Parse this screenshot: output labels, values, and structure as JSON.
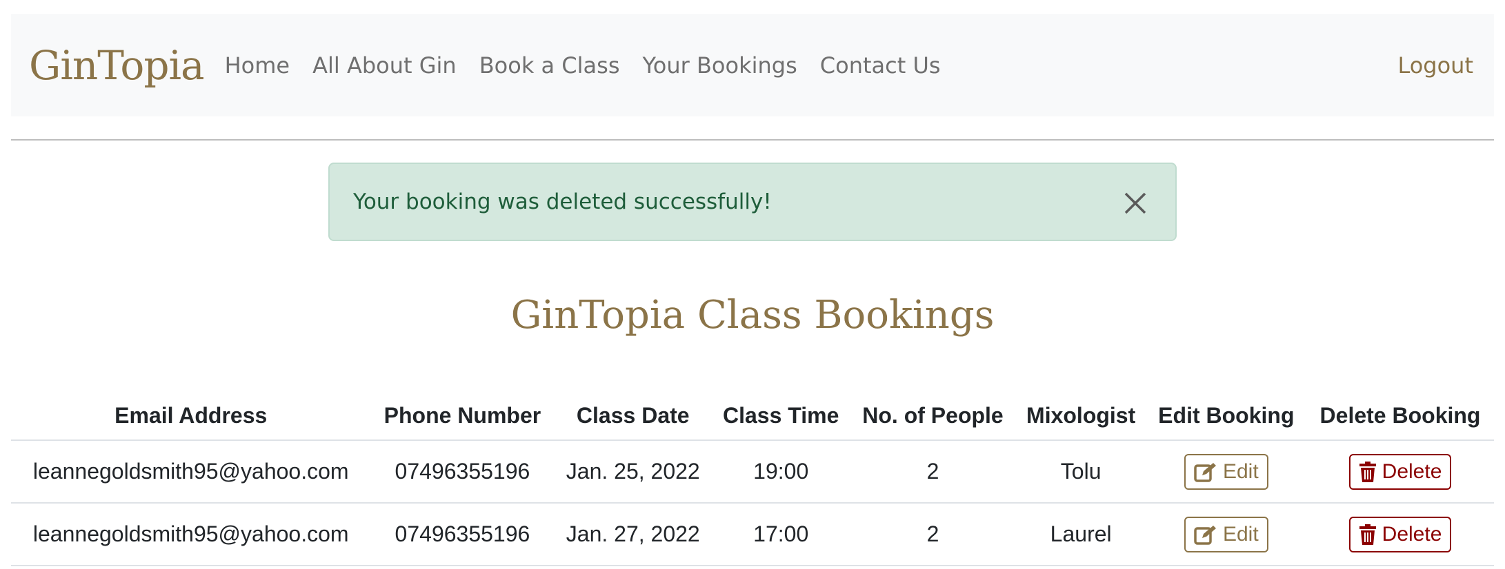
{
  "navbar": {
    "brand": "GinTopia",
    "links": [
      "Home",
      "All About Gin",
      "Book a Class",
      "Your Bookings",
      "Contact Us"
    ],
    "logout": "Logout"
  },
  "alert": {
    "message": "Your booking was deleted successfully!",
    "close_icon": "close-icon"
  },
  "page_title": "GinTopia Class Bookings",
  "table": {
    "headers": [
      "Email Address",
      "Phone Number",
      "Class Date",
      "Class Time",
      "No. of People",
      "Mixologist",
      "Edit Booking",
      "Delete Booking"
    ],
    "rows": [
      {
        "email": "leannegoldsmith95@yahoo.com",
        "phone": "07496355196",
        "date": "Jan. 25, 2022",
        "time": "19:00",
        "people": "2",
        "mixologist": "Tolu",
        "edit_label": "Edit",
        "delete_label": "Delete"
      },
      {
        "email": "leannegoldsmith95@yahoo.com",
        "phone": "07496355196",
        "date": "Jan. 27, 2022",
        "time": "17:00",
        "people": "2",
        "mixologist": "Laurel",
        "edit_label": "Edit",
        "delete_label": "Delete"
      }
    ]
  },
  "colors": {
    "brand": "#8b7448",
    "alert_bg": "#d4e8de",
    "alert_text": "#1e5d3a",
    "delete": "#8b0000"
  }
}
